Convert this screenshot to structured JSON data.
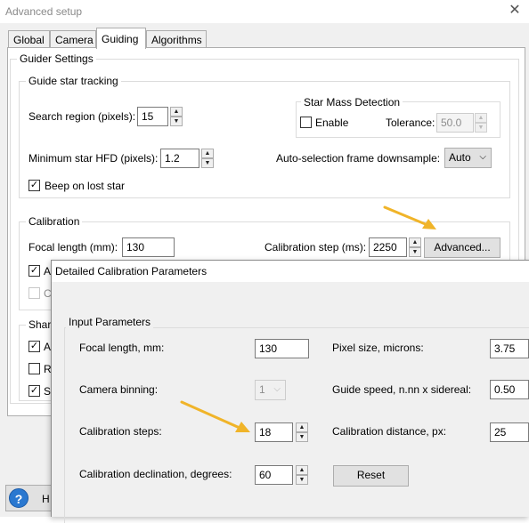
{
  "window": {
    "title": "Advanced setup"
  },
  "tabs": [
    {
      "label": "Global"
    },
    {
      "label": "Camera"
    },
    {
      "label": "Guiding",
      "active": true
    },
    {
      "label": "Algorithms"
    }
  ],
  "guider_settings": {
    "title": "Guider Settings",
    "tracking": {
      "title": "Guide star tracking",
      "search_region_label": "Search region (pixels):",
      "search_region_value": "15",
      "min_hfd_label": "Minimum star HFD (pixels):",
      "min_hfd_value": "1.2",
      "beep_label": "Beep on lost star",
      "beep_checked": "✓",
      "star_mass": {
        "title": "Star Mass Detection",
        "enable_label": "Enable",
        "tolerance_label": "Tolerance:",
        "tolerance_value": "50.0"
      },
      "downsample_label": "Auto-selection frame downsample:",
      "downsample_value": "Auto"
    },
    "calibration": {
      "title": "Calibration",
      "focal_length_label": "Focal length (mm):",
      "focal_length_value": "130",
      "step_label": "Calibration step (ms):",
      "step_value": "2250",
      "advanced_button": "Advanced...",
      "check1_partial": "A",
      "check1_mark": "✓",
      "check2_partial": "C"
    },
    "shared": {
      "title_partial": "Share",
      "row1_partial": "A",
      "row1_mark": "✓",
      "row2_partial": "Re",
      "row3_partial": "St",
      "row3_mark": "✓"
    }
  },
  "footer": {
    "help_icon": "?",
    "help_partial": "H"
  },
  "dialog": {
    "title": "Detailed Calibration Parameters",
    "group_title": "Input Parameters",
    "focal_length_label": "Focal length, mm:",
    "focal_length_value": "130",
    "pixel_size_label": "Pixel size, microns:",
    "pixel_size_value": "3.75",
    "binning_label": "Camera binning:",
    "binning_value": "1",
    "guide_speed_label": "Guide speed, n.nn x sidereal:",
    "guide_speed_value": "0.50",
    "steps_label": "Calibration steps:",
    "steps_value": "18",
    "distance_label": "Calibration distance, px:",
    "distance_value": "25",
    "declination_label": "Calibration declination, degrees:",
    "declination_value": "60",
    "reset_button": "Reset"
  },
  "annotations": {
    "arrow_color": "#f0b429"
  }
}
